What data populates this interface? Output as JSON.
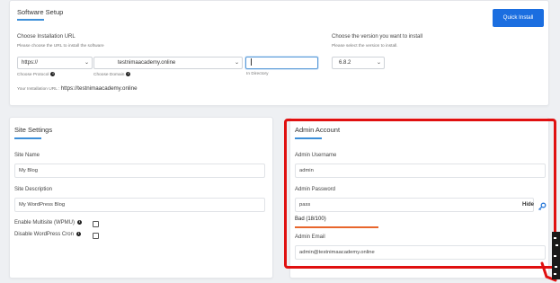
{
  "software_setup": {
    "title": "Software Setup",
    "quick_install_label": "Quick Install",
    "url_section_title": "Choose Installation URL",
    "url_section_hint": "Please choose the URL to install the software",
    "protocol_value": "https://",
    "protocol_label": "Choose Protocol",
    "domain_value": "testnimaacademy.online",
    "domain_label": "Choose Domain",
    "directory_value": "",
    "directory_label": "In Directory",
    "install_url_prefix": "Your Installation URL :",
    "install_url_value": "https://testnimaacademy.online",
    "version_section_title": "Choose the version you want to install",
    "version_section_hint": "Please select the version to install.",
    "version_value": "6.8.2"
  },
  "site_settings": {
    "title": "Site Settings",
    "site_name_label": "Site Name",
    "site_name_value": "My Blog",
    "site_description_label": "Site Description",
    "site_description_value": "My WordPress Blog",
    "multisite_label": "Enable Multisite (WPMU)",
    "disable_cron_label": "Disable WordPress Cron"
  },
  "admin_account": {
    "title": "Admin Account",
    "username_label": "Admin Username",
    "username_value": "admin",
    "password_label": "Admin Password",
    "password_value": "pass",
    "hide_label": "Hide",
    "strength_label": "Bad (18/100)",
    "strength_color": "#e8662c",
    "email_label": "Admin Email",
    "email_value": "admin@testnimaacademy.online"
  },
  "colors": {
    "accent": "#1b6ee0",
    "annotation": "#e01010"
  }
}
